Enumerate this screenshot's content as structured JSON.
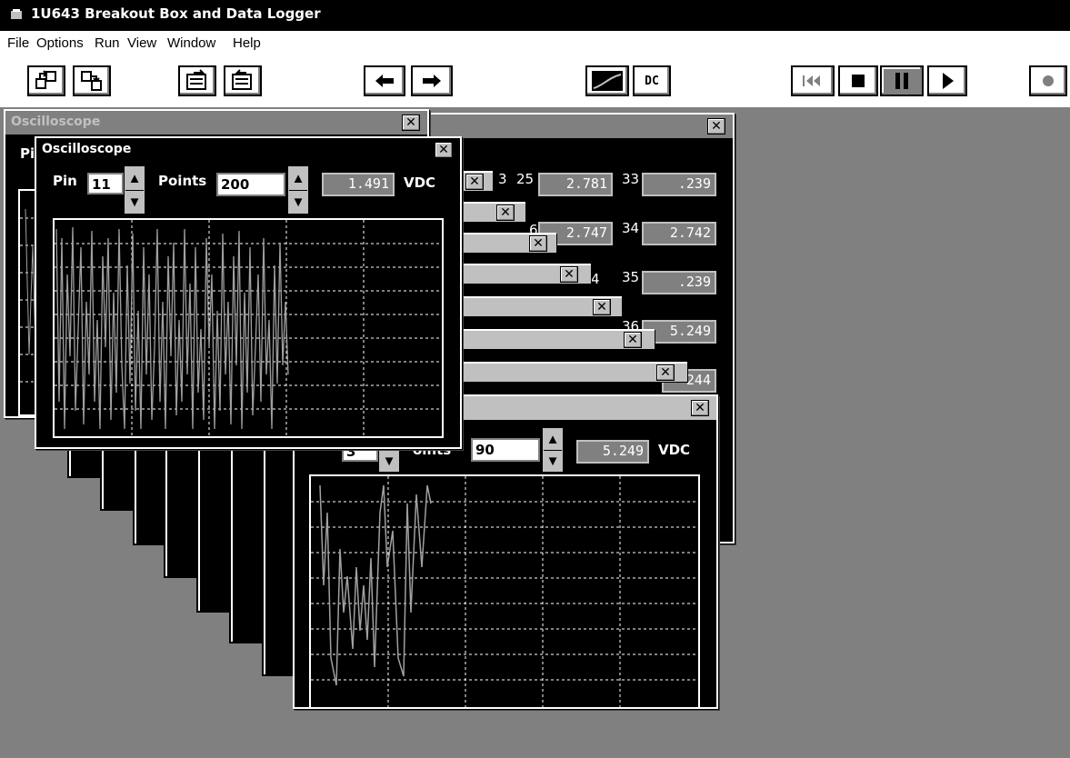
{
  "app": {
    "title": "1U643 Breakout Box and Data Logger"
  },
  "menu": [
    "File",
    "Options",
    "Run",
    "View",
    "Window",
    "Help"
  ],
  "toolbar": {
    "dc_label": "DC",
    "buttons": [
      "open-config-icon",
      "save-config-icon",
      "load-setup-icon",
      "save-setup-icon",
      "arrow-left-icon",
      "arrow-right-icon",
      "waveform-icon",
      "dc-mode-icon",
      "rewind-icon",
      "stop-icon",
      "pause-icon",
      "play-icon",
      "record-icon"
    ]
  },
  "back_scope": {
    "title": "Oscilloscope",
    "pin_label_partial": "Pi"
  },
  "front_scope": {
    "title": "Oscilloscope",
    "pin_label": "Pin",
    "pin_value": "11",
    "points_label": "Points",
    "points_value": "200",
    "reading": "1.491",
    "unit": "VDC"
  },
  "bottom_scope": {
    "pin_value": "3",
    "points_label_partial": "oints",
    "points_value": "90",
    "reading": "5.249",
    "unit": "VDC"
  },
  "pin_table": {
    "rows": [
      {
        "pin_a": "25",
        "val_a": "2.781",
        "pin_b": "33",
        "val_b": ".239"
      },
      {
        "pin_a": "",
        "val_a": "2.747",
        "pin_b": "34",
        "val_b": "2.742"
      },
      {
        "pin_a": "",
        "val_a": "",
        "pin_b": "35",
        "val_b": ".239"
      },
      {
        "pin_a": "",
        "val_a": "",
        "pin_b": "36",
        "val_b": "5.249"
      },
      {
        "pin_a": "",
        "val_a": "",
        "pin_b": "",
        "val_b": "244"
      }
    ],
    "partial_pins": [
      "3",
      "6",
      "4"
    ]
  },
  "colors": {
    "title_active": "#000000",
    "face": "#c0c0c0",
    "desktop": "#808080",
    "trace": "#a0a0a0"
  }
}
